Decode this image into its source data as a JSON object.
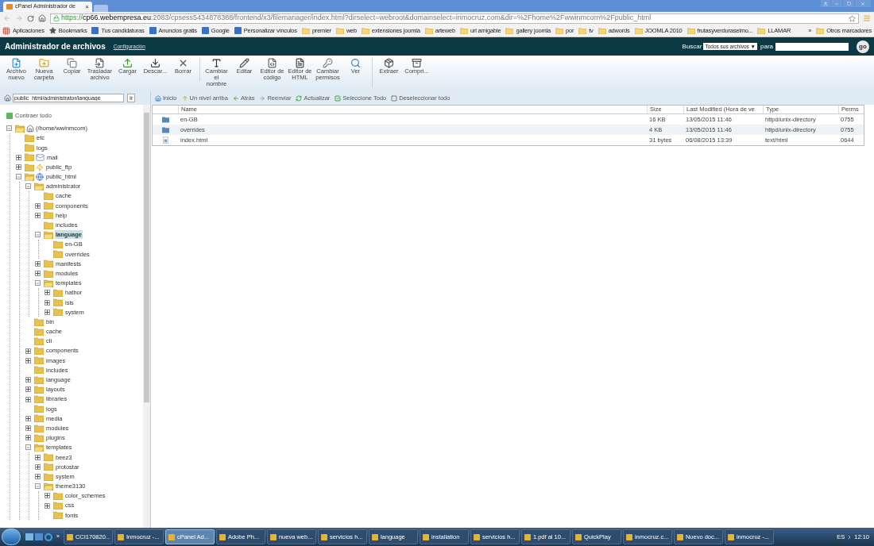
{
  "browser": {
    "tab": {
      "title": "cPanel Administrador de",
      "close": "×"
    },
    "url": {
      "scheme": "https://",
      "host": "cp66.webempresa.eu",
      "rest": ":2083/cpsess5434878388/frontend/x3/filemanager/index.html?dirselect=webroot&domainselect=inmocruz.com&dir=%2Fhome%2Fwwinmcom%2Fpublic_html"
    },
    "bookmarks": [
      {
        "kind": "apps",
        "label": "Aplicaciones"
      },
      {
        "kind": "star",
        "label": "Bookmarks"
      },
      {
        "kind": "site",
        "label": "Tus candidaturas"
      },
      {
        "kind": "site",
        "label": "Anuncios gratis"
      },
      {
        "kind": "site",
        "label": "Google"
      },
      {
        "kind": "site",
        "label": "Personalizar vínculos"
      },
      {
        "kind": "folder",
        "label": "premier"
      },
      {
        "kind": "folder",
        "label": "web"
      },
      {
        "kind": "folder",
        "label": "extensiones joomla"
      },
      {
        "kind": "folder",
        "label": "arteweb"
      },
      {
        "kind": "folder",
        "label": "url amigable"
      },
      {
        "kind": "folder",
        "label": "gallery joomla"
      },
      {
        "kind": "folder",
        "label": "por"
      },
      {
        "kind": "folder",
        "label": "tv"
      },
      {
        "kind": "folder",
        "label": "adwords"
      },
      {
        "kind": "folder",
        "label": "JOOMLA 2010"
      },
      {
        "kind": "folder",
        "label": "frutasyverduraselmo..."
      },
      {
        "kind": "folder",
        "label": "LLAMAR"
      }
    ],
    "more": "»",
    "other_bookmarks": "Otros marcadores"
  },
  "header": {
    "title": "Administrador de archivos",
    "settings_link": "Configuración",
    "search_label": "Buscar",
    "search_scope": "Todos sus archivos ▼",
    "for_label": "para",
    "go": "go"
  },
  "toolbar": [
    [
      {
        "kind": "new-file",
        "label": "Archivo nuevo"
      },
      {
        "kind": "new-folder",
        "label": "Nueva carpeta"
      },
      {
        "kind": "copy",
        "label": "Copiar"
      },
      {
        "kind": "move",
        "label": "Trasladar archivo"
      },
      {
        "kind": "upload",
        "label": "Cargar"
      },
      {
        "kind": "download",
        "label": "Descar..."
      },
      {
        "kind": "delete",
        "label": "Borrar"
      }
    ],
    [
      {
        "kind": "rename",
        "label": "Cambiar el nombre"
      },
      {
        "kind": "edit",
        "label": "Editar"
      },
      {
        "kind": "code",
        "label": "Editor de código"
      },
      {
        "kind": "html",
        "label": "Editor de HTML"
      },
      {
        "kind": "permissions",
        "label": "Cambiar permisos"
      },
      {
        "kind": "view",
        "label": "Ver"
      }
    ],
    [
      {
        "kind": "extract",
        "label": "Extraer"
      },
      {
        "kind": "compress",
        "label": "Compri..."
      }
    ]
  ],
  "path": {
    "value": "public_html/administrator/language",
    "go": "Ir"
  },
  "tree": {
    "collapse_all": "Contraer todo",
    "root": {
      "label": "(/home/wwinmcom)",
      "expanded": true,
      "selected": false,
      "children": [
        {
          "kind": "folder",
          "label": "etc",
          "selected": false
        },
        {
          "kind": "folder",
          "label": "logs",
          "selected": false
        },
        {
          "kind": "mail",
          "label": "mail",
          "expanded": false,
          "selected": false
        },
        {
          "kind": "ftp",
          "label": "public_ftp",
          "expanded": false,
          "selected": false
        },
        {
          "kind": "web",
          "label": "public_html",
          "expanded": true,
          "selected": false,
          "children": [
            {
              "label": "administrator",
              "expanded": true,
              "selected": false,
              "children": [
                {
                  "label": "cache",
                  "selected": false
                },
                {
                  "label": "components",
                  "expanded": false,
                  "selected": false
                },
                {
                  "label": "help",
                  "expanded": false,
                  "selected": false
                },
                {
                  "label": "includes",
                  "selected": false
                },
                {
                  "label": "language",
                  "expanded": true,
                  "selected": true,
                  "children": [
                    {
                      "label": "en-GB",
                      "selected": false
                    },
                    {
                      "label": "overrides",
                      "selected": false
                    }
                  ]
                },
                {
                  "label": "manifests",
                  "expanded": false,
                  "selected": false
                },
                {
                  "label": "modules",
                  "expanded": false,
                  "selected": false
                },
                {
                  "label": "templates",
                  "expanded": true,
                  "selected": false,
                  "children": [
                    {
                      "label": "hathor",
                      "expanded": false,
                      "selected": false
                    },
                    {
                      "label": "isis",
                      "expanded": false,
                      "selected": false
                    },
                    {
                      "label": "system",
                      "expanded": false,
                      "selected": false
                    }
                  ]
                }
              ]
            },
            {
              "label": "bin",
              "selected": false
            },
            {
              "label": "cache",
              "selected": false
            },
            {
              "label": "cli",
              "selected": false
            },
            {
              "label": "components",
              "expanded": false,
              "selected": false
            },
            {
              "label": "images",
              "expanded": false,
              "selected": false
            },
            {
              "label": "includes",
              "selected": false
            },
            {
              "label": "language",
              "expanded": false,
              "selected": false
            },
            {
              "label": "layouts",
              "expanded": false,
              "selected": false
            },
            {
              "label": "libraries",
              "expanded": false,
              "selected": false
            },
            {
              "label": "logs",
              "selected": false
            },
            {
              "label": "media",
              "expanded": false,
              "selected": false
            },
            {
              "label": "modules",
              "expanded": false,
              "selected": false
            },
            {
              "label": "plugins",
              "expanded": false,
              "selected": false
            },
            {
              "label": "templates",
              "expanded": true,
              "selected": false,
              "children": [
                {
                  "label": "beez3",
                  "expanded": false,
                  "selected": false
                },
                {
                  "label": "protostar",
                  "expanded": false,
                  "selected": false
                },
                {
                  "label": "system",
                  "expanded": false,
                  "selected": false
                },
                {
                  "label": "theme3130",
                  "expanded": true,
                  "selected": false,
                  "children": [
                    {
                      "label": "color_schemes",
                      "expanded": false,
                      "selected": false
                    },
                    {
                      "label": "css",
                      "expanded": false,
                      "selected": false
                    },
                    {
                      "label": "fonts",
                      "selected": false
                    }
                  ]
                }
              ]
            }
          ]
        }
      ]
    }
  },
  "nav": [
    {
      "kind": "home",
      "label": "Inicio"
    },
    {
      "kind": "up",
      "label": "Un nivel arriba"
    },
    {
      "kind": "back",
      "label": "Atrás"
    },
    {
      "kind": "forward",
      "label": "Reenviar"
    },
    {
      "kind": "refresh",
      "label": "Actualizar"
    },
    {
      "kind": "select-all",
      "label": "Seleccione Todo"
    },
    {
      "kind": "deselect",
      "label": "Deseleccionar todo"
    }
  ],
  "table": {
    "columns": [
      "Name",
      "Size",
      "Last Modified (Hora de ve",
      "Type",
      "Perms"
    ],
    "rows": [
      {
        "kind": "folder",
        "name": "en-GB",
        "size": "16 KB",
        "modified": "13/05/2015 11:46",
        "type": "httpd/unix-directory",
        "perms": "0755"
      },
      {
        "kind": "folder",
        "name": "overrides",
        "size": "4 KB",
        "modified": "13/05/2015 11:46",
        "type": "httpd/unix-directory",
        "perms": "0755"
      },
      {
        "kind": "file",
        "name": "index.html",
        "size": "31 bytes",
        "modified": "06/08/2015 13:39",
        "type": "text/html",
        "perms": "0644"
      }
    ]
  },
  "taskbar": {
    "items": [
      {
        "label": "CCI170820...",
        "selected": false
      },
      {
        "label": "Inmocruz -...",
        "selected": false
      },
      {
        "label": "cPanel Ad...",
        "selected": true
      },
      {
        "label": "Adobe Ph...",
        "selected": false
      },
      {
        "label": "nueva web...",
        "selected": false
      },
      {
        "label": "servicios h...",
        "selected": false
      },
      {
        "label": "language",
        "selected": false
      },
      {
        "label": "installation",
        "selected": false
      },
      {
        "label": "servicios h...",
        "selected": false
      },
      {
        "label": "1.pdf al 10...",
        "selected": false
      },
      {
        "label": "QuickPlay",
        "selected": false
      },
      {
        "label": "inmocruz.c...",
        "selected": false
      },
      {
        "label": "Nuevo doc...",
        "selected": false
      },
      {
        "label": "inmocruz -...",
        "selected": false
      }
    ],
    "more": "»",
    "language": "ES",
    "clock": "12:10"
  }
}
